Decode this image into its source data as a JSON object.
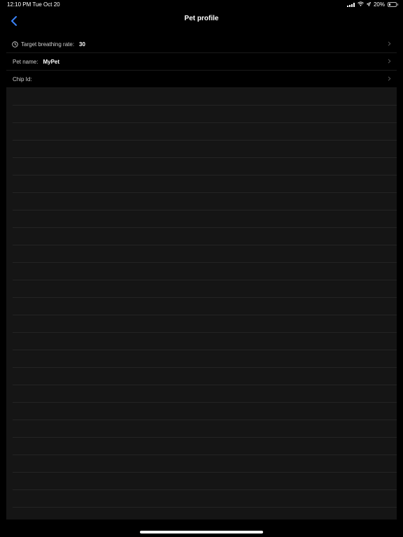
{
  "status_bar": {
    "time_date": "12:10 PM   Tue Oct 20",
    "battery_text": "20%",
    "battery_level": 0.2
  },
  "nav": {
    "title": "Pet profile",
    "back_icon": "chevron-left-icon",
    "accent_color": "#3a82f7"
  },
  "rows": [
    {
      "label": "Target breathing rate:",
      "value": "30",
      "icon": "clock-icon"
    },
    {
      "label": "Pet name:",
      "value": "MyPet"
    },
    {
      "label": "Chip Id:",
      "value": ""
    }
  ],
  "colors": {
    "background": "#000000",
    "notes_background": "#151515",
    "notes_line": "#242424"
  }
}
